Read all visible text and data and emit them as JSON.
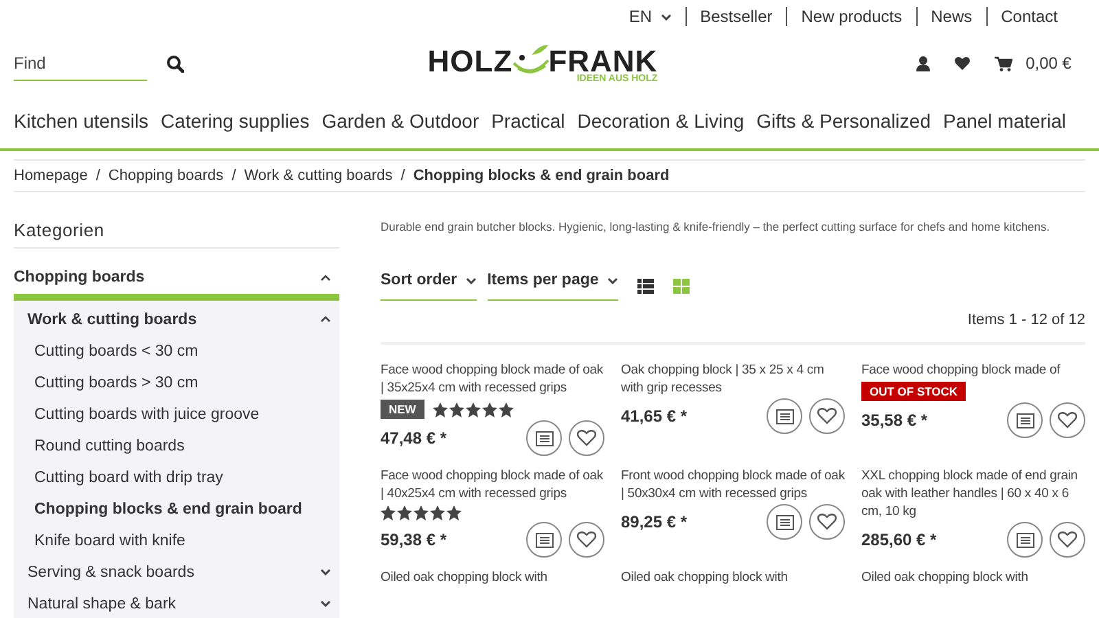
{
  "top_links": [
    {
      "label": "EN",
      "kind": "dropdown"
    },
    {
      "label": "Bestseller",
      "kind": "link"
    },
    {
      "label": "New products",
      "kind": "link"
    },
    {
      "label": "News",
      "kind": "link"
    },
    {
      "label": "Contact",
      "kind": "link"
    }
  ],
  "search": {
    "placeholder": "Find"
  },
  "logo": {
    "left": "HOLZ",
    "right": "FRANK",
    "tagline": "IDEEN AUS HOLZ"
  },
  "cart": {
    "total": "0,00 €"
  },
  "nav": [
    "Kitchen utensils",
    "Catering supplies",
    "Garden & Outdoor",
    "Practical",
    "Decoration & Living",
    "Gifts & Personalized",
    "Panel material"
  ],
  "breadcrumb_separator": "/",
  "breadcrumb": [
    {
      "label": "Homepage",
      "current": false
    },
    {
      "label": "Chopping boards",
      "current": false
    },
    {
      "label": "Work & cutting boards",
      "current": false
    },
    {
      "label": "Chopping blocks & end grain board",
      "current": true
    }
  ],
  "sidebar": {
    "title": "Kategorien",
    "items": [
      {
        "label": "Chopping boards",
        "expanded": true,
        "children": [
          {
            "label": "Work & cutting boards",
            "expanded": true,
            "children": [
              {
                "label": "Cutting boards < 30 cm",
                "selected": false
              },
              {
                "label": "Cutting boards > 30 cm",
                "selected": false
              },
              {
                "label": "Cutting boards with juice groove",
                "selected": false
              },
              {
                "label": "Round cutting boards",
                "selected": false
              },
              {
                "label": "Cutting board with drip tray",
                "selected": false
              },
              {
                "label": "Chopping blocks & end grain board",
                "selected": true
              },
              {
                "label": "Knife board with knife",
                "selected": false
              }
            ]
          },
          {
            "label": "Serving & snack boards",
            "expanded": false
          },
          {
            "label": "Natural shape & bark",
            "expanded": false
          }
        ]
      }
    ]
  },
  "description": "Durable end grain butcher blocks. Hygienic, long-lasting & knife-friendly – the perfect cutting surface for chefs and home kitchens.",
  "toolbar": {
    "sort": "Sort order",
    "per_page": "Items per page",
    "views": [
      {
        "kind": "list",
        "selected": false
      },
      {
        "kind": "grid",
        "selected": true
      }
    ],
    "count": "Items 1 - 12 of 12"
  },
  "products": [
    {
      "name": "Face wood chopping block made of oak | 35x25x4 cm with recessed grips",
      "badge": {
        "kind": "new",
        "label": "NEW"
      },
      "stars": 5,
      "price": "47,48 € *"
    },
    {
      "name": "Oak chopping block | 35 x 25 x 4 cm with grip recesses",
      "price": "41,65 € *"
    },
    {
      "name": "Face wood chopping block made of",
      "badge": {
        "kind": "stock",
        "label": "OUT OF STOCK"
      },
      "price": "35,58 € *"
    },
    {
      "name": "Face wood chopping block made of oak | 40x25x4 cm with recessed grips",
      "stars": 5,
      "price": "59,38 € *"
    },
    {
      "name": "Front wood chopping block made of oak | 50x30x4 cm with recessed grips",
      "price": "89,25 € *"
    },
    {
      "name": "XXL chopping block made of end grain oak with leather handles | 60 x 40 x 6 cm, 10 kg",
      "price": "285,60 € *"
    },
    {
      "name": "Oiled oak chopping block with"
    },
    {
      "name": "Oiled oak chopping block with"
    },
    {
      "name": "Oiled oak chopping block with"
    }
  ]
}
